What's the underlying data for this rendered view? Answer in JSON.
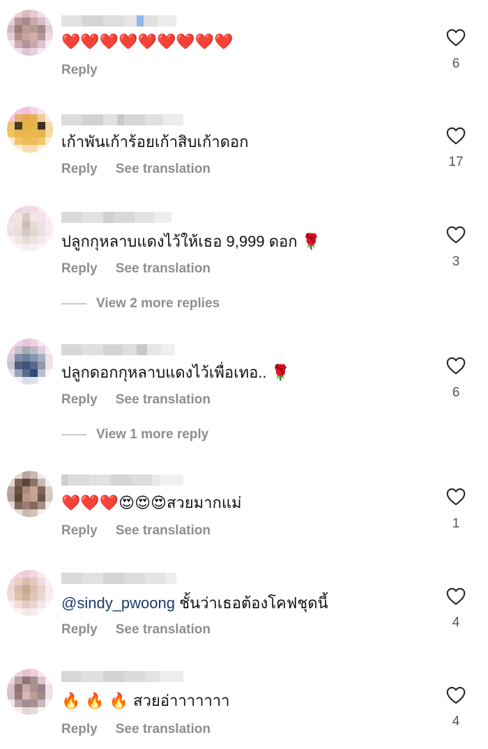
{
  "labels": {
    "reply": "Reply",
    "see_translation": "See translation"
  },
  "comments": [
    {
      "text": "❤️❤️❤️❤️❤️❤️❤️❤️❤️",
      "likes": "6",
      "show_translation": false
    },
    {
      "text": "เก้าพันเก้าร้อยเก้าสิบเก้าดอก",
      "likes": "17",
      "show_translation": true
    },
    {
      "text": "ปลูกกุหลาบแดงไว้ให้เธอ 9,999 ดอก 🌹",
      "likes": "3",
      "show_translation": true,
      "more_replies": "View 2 more replies"
    },
    {
      "text": "ปลูกดอกกุหลาบแดงไว้เพื่อเทอ.. 🌹",
      "likes": "6",
      "show_translation": true,
      "more_replies": "View 1 more reply"
    },
    {
      "text": "❤️❤️❤️😍😍😍สวยมากแม่",
      "likes": "1",
      "show_translation": true
    },
    {
      "mention": "@sindy_pwoong",
      "text": " ชั้นว่าเธอต้องโคฟชุดนี้",
      "likes": "4",
      "show_translation": true
    },
    {
      "text": "🔥 🔥 🔥 สวยอ่าาาาาาา",
      "likes": "4",
      "show_translation": true
    }
  ],
  "icons": {
    "like": "heart-outline-icon"
  },
  "colors": {
    "muted": "#8e8e8e",
    "mention": "#1b3a6b"
  }
}
